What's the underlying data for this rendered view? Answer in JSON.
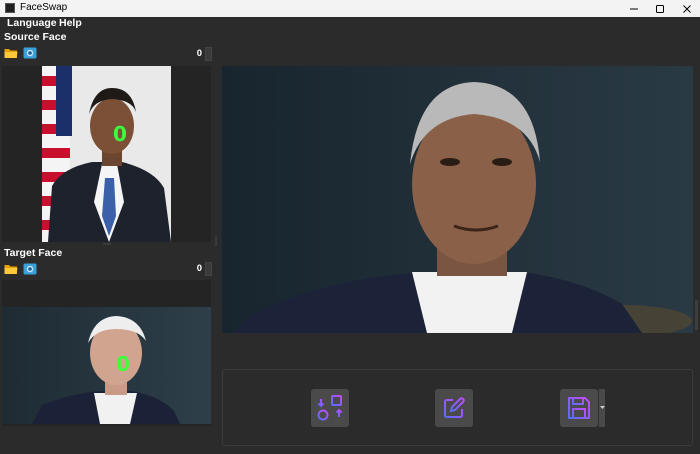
{
  "window": {
    "title": "FaceSwap"
  },
  "menu": {
    "items": [
      "Language",
      "Help"
    ]
  },
  "source": {
    "title": "Source Face",
    "count": "0",
    "face_label": "0"
  },
  "target": {
    "title": "Target Face",
    "count": "0",
    "face_label": "0"
  },
  "colors": {
    "accent": "#3bff3b",
    "folder": "#f0b429",
    "camera": "#3aa0d8",
    "action_start": "#6a5cff",
    "action_end": "#c34bff"
  },
  "icons": {
    "folder": "folder-icon",
    "camera": "camera-icon",
    "swap": "swap-faces-icon",
    "edit": "edit-icon",
    "save": "save-icon"
  }
}
